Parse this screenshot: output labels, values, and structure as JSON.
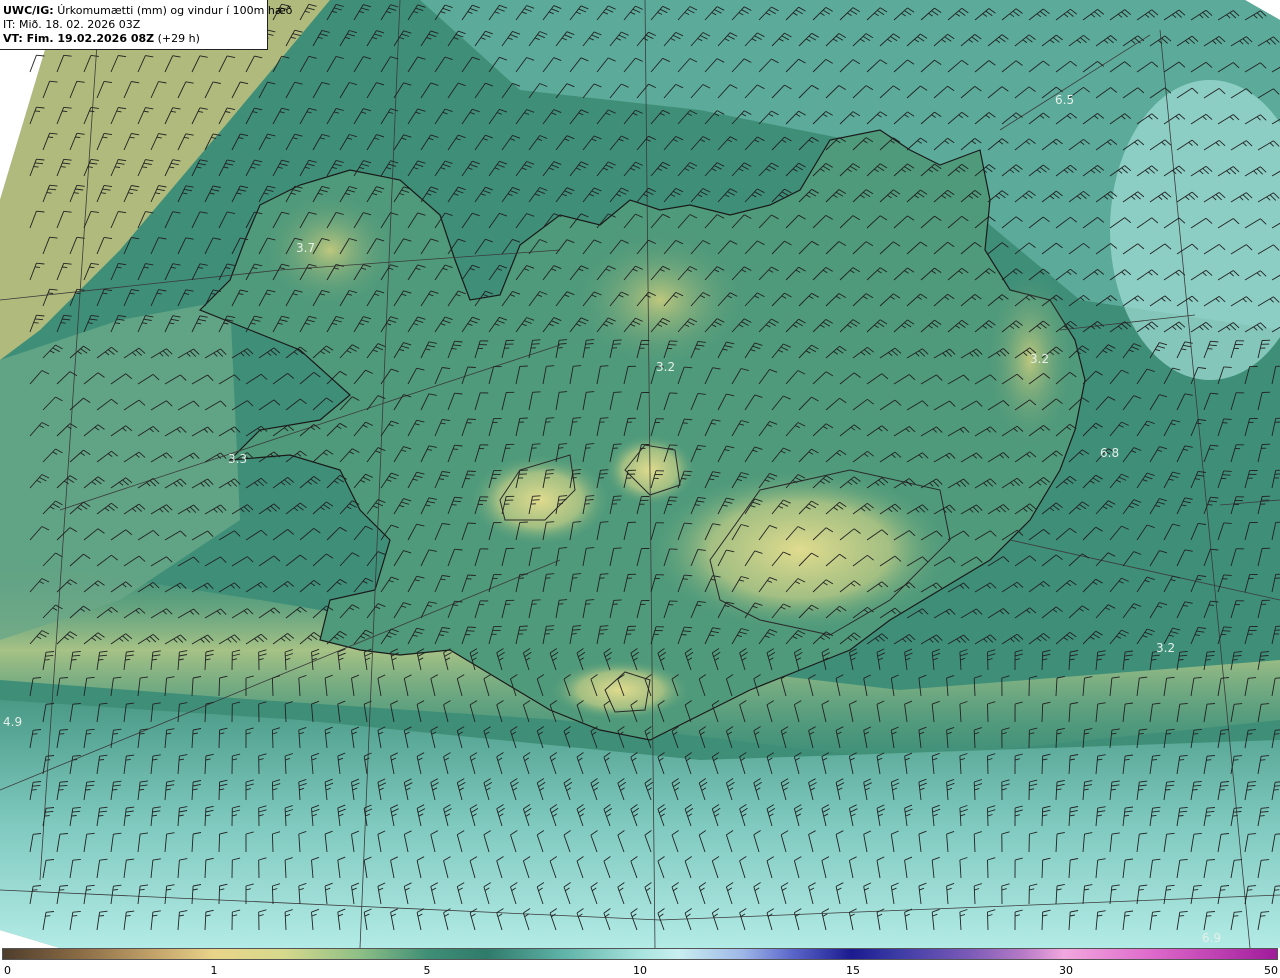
{
  "title": {
    "model": "UWC/IG:",
    "description": "Úrkomumætti (mm) og vindur í 100m hæð",
    "init_time": "IT: Mið. 18. 02. 2026 03Z",
    "valid_label": "VT: Fim. 19.02.2026 08Z",
    "lead": "(+29 h)"
  },
  "colorbar": {
    "unit": "mm",
    "ticks": [
      "0",
      "1",
      "5",
      "10",
      "15",
      "30",
      "50"
    ]
  },
  "map_labels": [
    "6.5",
    "3.7",
    "3.2",
    "3.2",
    "3.3",
    "6.8",
    "3.2",
    "4.9",
    "6.9"
  ],
  "colors": {
    "dry": "#e6d88a",
    "moderate": "#3d8a72",
    "wet": "#a8e3de",
    "coastline": "#1a1a1a",
    "wind_barb": "#222222",
    "grid": "#3a3a3a"
  },
  "wind_barbs": {
    "description_note": "wind barbs shown across the domain, predominantly from the southwest/west"
  }
}
